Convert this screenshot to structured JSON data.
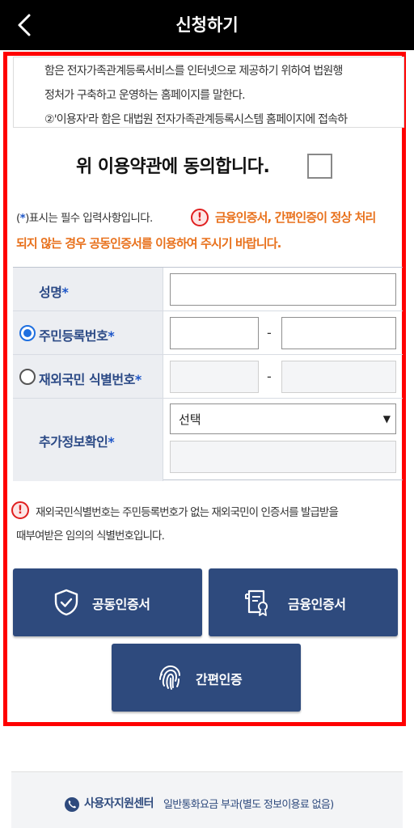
{
  "header": {
    "title": "신청하기"
  },
  "terms": {
    "lines": [
      "함은 전자가족관계등록서비스를 인터넷으로 제공하기 위하여 법원행",
      "정처가 구축하고 운영하는 홈페이지를 말한다.",
      "②'이용자'라 함은 대법원 전자가족관계등록시스템 홈페이지에 접속하"
    ]
  },
  "agreement": {
    "label": "위 이용약관에 동의합니다.",
    "checked": false
  },
  "notes": {
    "required_open": "(",
    "required_star": "*",
    "required_rest": ")표시는 필수 입력사항입니다.",
    "warning_line1": "금융인증서, 간편인증이 정상 처리",
    "warning_line2": "되지 않는 경우 공동인증서를 이용하여 주시기 바랍니다.",
    "warning_symbol": "!"
  },
  "form": {
    "name_label": "성명",
    "rrn_label": "주민등록번호",
    "foreign_label": "재외국민 식별번호",
    "extra_label": "추가정보확인",
    "star": "*",
    "dash": "-",
    "select_value": "선택",
    "select_arrow": "▼",
    "selected_id_type": "rrn"
  },
  "info": {
    "line1": "재외국민식별번호는 주민등록번호가 없는 재외국민이 인증서를 발급받을",
    "line2": "때부여받은 임의의 식별번호입니다."
  },
  "buttons": {
    "joint_cert": "공동인증서",
    "financial_cert": "금융인증서",
    "simple_auth": "간편인증"
  },
  "footer": {
    "title": "사용자지원센터",
    "desc": "일반통화요금 부과(별도 정보이용료 없음)"
  },
  "colors": {
    "header_bg": "#000000",
    "frame_red": "#ff0000",
    "button_navy": "#2e4a7d",
    "warning_orange": "#e8711c",
    "label_blue": "#2c4a86",
    "radio_blue": "#1e6fe0"
  }
}
